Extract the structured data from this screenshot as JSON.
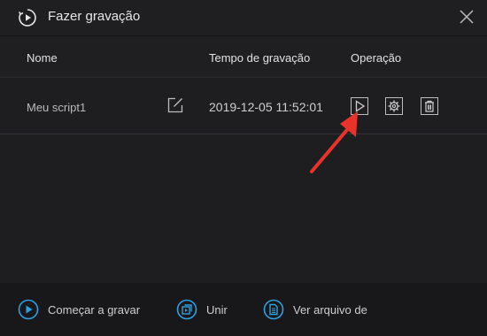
{
  "window": {
    "title": "Fazer gravação",
    "title_icon": "record-play-icon",
    "close_icon": "close-icon"
  },
  "table": {
    "columns": [
      "Nome",
      "Tempo de gravação",
      "Operação"
    ],
    "rows": [
      {
        "name": "Meu script1",
        "time": "2019-12-05 11:52:01",
        "actions": [
          "edit-icon",
          "play-icon",
          "settings-icon",
          "delete-icon"
        ]
      }
    ]
  },
  "annotation": {
    "arrow_icon": "red-arrow-icon",
    "arrow_color": "#e8332b"
  },
  "footer": {
    "items": [
      {
        "label": "Começar a gravar",
        "icon": "record-start-icon"
      },
      {
        "label": "Unir",
        "icon": "merge-icon"
      },
      {
        "label": "Ver arquivo de",
        "icon": "file-icon"
      }
    ]
  },
  "colors": {
    "accent": "#2f9fe0",
    "background": "#1f1f21",
    "footer_background": "#18181a"
  }
}
